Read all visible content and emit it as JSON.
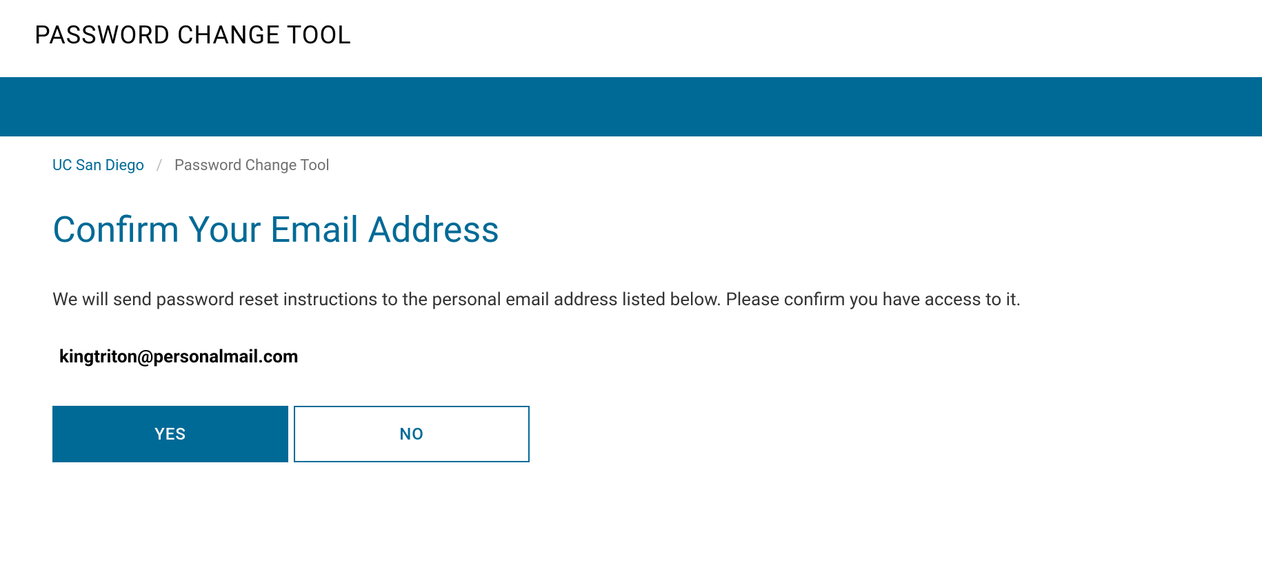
{
  "header": {
    "title": "PASSWORD CHANGE TOOL"
  },
  "breadcrumb": {
    "home_label": "UC San Diego",
    "separator": "/",
    "current_label": "Password Change Tool"
  },
  "main": {
    "heading": "Confirm Your Email Address",
    "body_text": "We will send password reset instructions to the personal email address listed below. Please confirm you have access to it.",
    "email": "kingtriton@personalmail.com"
  },
  "buttons": {
    "yes_label": "YES",
    "no_label": "NO"
  },
  "colors": {
    "brand_blue": "#006a96"
  }
}
